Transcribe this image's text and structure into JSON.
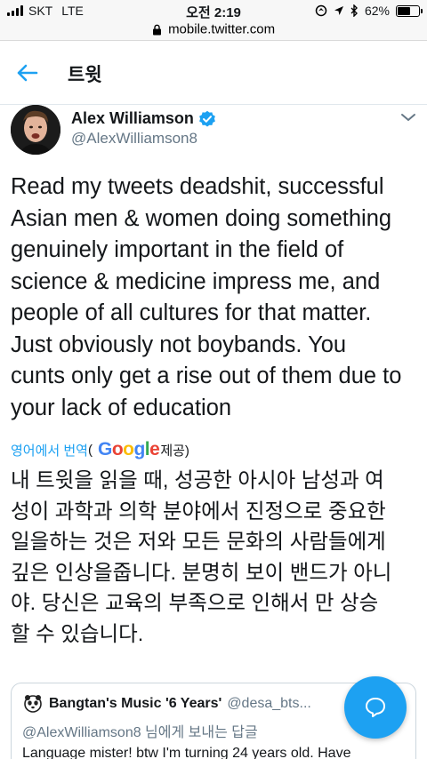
{
  "status_bar": {
    "carrier": "SKT",
    "network": "LTE",
    "time": "오전 2:19",
    "battery": "62%",
    "battery_level": 0.62,
    "icons": [
      "signal-icon",
      "location-lock-icon",
      "location-arrow-icon",
      "bluetooth-icon",
      "battery-icon"
    ]
  },
  "browser": {
    "url": "mobile.twitter.com",
    "icons": [
      "lock-icon"
    ]
  },
  "header": {
    "title": "트윗",
    "icons": [
      "back-arrow-icon"
    ]
  },
  "tweet": {
    "author_name": "Alex Williamson",
    "author_handle": "@AlexWilliamson8",
    "verified": true,
    "text": "Read my tweets deadshit, successful\nAsian men & women doing something\ngenuinely important in the field of\nscience & medicine impress me, and\npeople of all cultures for that matter.\nJust obviously not boybands. You\ncunts only get a rise out of them due to\nyour lack of education",
    "translate_label": "영어에서 번역",
    "translate_paren_open": "(",
    "google_letters": [
      "G",
      "o",
      "o",
      "g",
      "l",
      "e"
    ],
    "google_colors": [
      "#4285F4",
      "#EA4335",
      "#FBBC05",
      "#4285F4",
      "#34A853",
      "#EA4335"
    ],
    "translate_provider_suffix": "제공)",
    "translated_text": "내 트윗을 읽을 때, 성공한 아시아 남성과 여\n성이 과학과 의학 분야에서 진정으로 중요한\n일을하는 것은 저와 모든 문화의 사람들에게\n깊은 인상을줍니다. 분명히 보이 밴드가 아니\n야. 당신은 교육의 부족으로 인해서 만 상승\n할 수 있습니다."
  },
  "quoted_tweet": {
    "name": "Bangtan's Music '6 Years'",
    "handle": "@desa_bts...",
    "reply_to": "@AlexWilliamson8 님에게 보내는 답글",
    "body": "Language mister! btw I'm turning 24 years old. Have"
  },
  "colors": {
    "accent": "#1da1f2",
    "text": "#14171a",
    "secondary": "#657786"
  }
}
